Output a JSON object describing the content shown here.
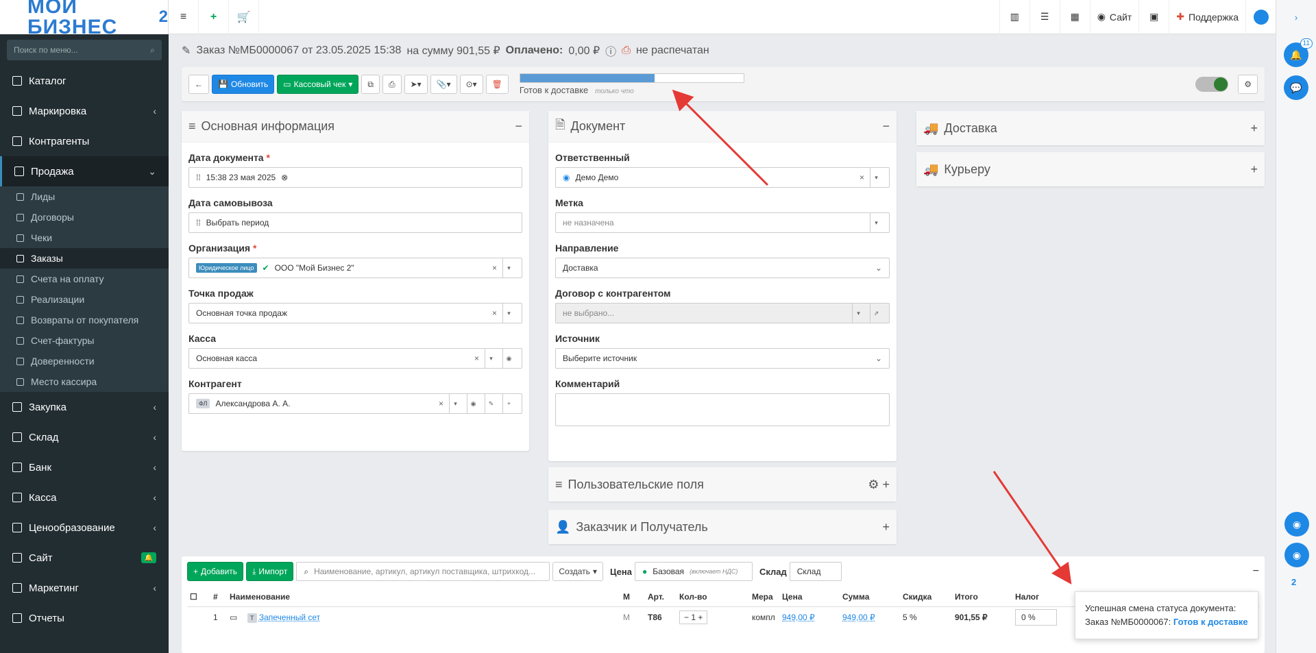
{
  "logo": {
    "text": "МОЙ БИЗНЕС",
    "suffix": "2"
  },
  "sidebar": {
    "search_placeholder": "Поиск по меню...",
    "items": [
      {
        "label": "Каталог",
        "chev": ""
      },
      {
        "label": "Маркировка",
        "chev": "‹"
      },
      {
        "label": "Контрагенты",
        "chev": ""
      },
      {
        "label": "Продажа",
        "chev": "⌄"
      }
    ],
    "sub": [
      {
        "label": "Лиды"
      },
      {
        "label": "Договоры"
      },
      {
        "label": "Чеки"
      },
      {
        "label": "Заказы"
      },
      {
        "label": "Счета на оплату"
      },
      {
        "label": "Реализации"
      },
      {
        "label": "Возвраты от покупателя"
      },
      {
        "label": "Счет-фактуры"
      },
      {
        "label": "Доверенности"
      },
      {
        "label": "Место кассира"
      }
    ],
    "items2": [
      {
        "label": "Закупка",
        "chev": "‹"
      },
      {
        "label": "Склад",
        "chev": "‹"
      },
      {
        "label": "Банк",
        "chev": "‹"
      },
      {
        "label": "Касса",
        "chev": "‹"
      },
      {
        "label": "Ценообразование",
        "chev": "‹"
      },
      {
        "label": "Сайт",
        "chev": ""
      },
      {
        "label": "Маркетинг",
        "chev": "‹"
      },
      {
        "label": "Отчеты",
        "chev": ""
      }
    ]
  },
  "topbar": {
    "site": "Сайт",
    "support": "Поддержка"
  },
  "title": {
    "order": "Заказ №МБ0000067 от 23.05.2025 15:38",
    "sum": "на сумму 901,55 ₽",
    "paid_label": "Оплачено:",
    "paid": "0,00 ₽",
    "printed": "не распечатан"
  },
  "toolbar": {
    "refresh": "Обновить",
    "cashcheck": "Кассовый чек"
  },
  "progress": {
    "fraction": 0.6,
    "label": "Готов к доставке",
    "hint": "только что"
  },
  "main": {
    "title": "Основная информация",
    "date_label": "Дата документа",
    "date_value": "15:38 23 мая 2025",
    "pickup_label": "Дата самовывоза",
    "pickup_value": "Выбрать период",
    "org_label": "Организация",
    "org_tag": "Юридическое лицо",
    "org_value": "ООО \"Мой Бизнес 2\"",
    "pos_label": "Точка продаж",
    "pos_value": "Основная точка продаж",
    "cash_label": "Касса",
    "cash_value": "Основная касса",
    "ca_label": "Контрагент",
    "ca_tag": "ФЛ",
    "ca_value": "Александрова А. А."
  },
  "doc": {
    "title": "Документ",
    "resp_label": "Ответственный",
    "resp_value": "Демо Демо",
    "mark_label": "Метка",
    "mark_value": "не назначена",
    "dir_label": "Направление",
    "dir_value": "Доставка",
    "contract_label": "Договор с контрагентом",
    "contract_value": "не выбрано...",
    "src_label": "Источник",
    "src_value": "Выберите источник",
    "comment_label": "Комментарий"
  },
  "delivery": {
    "title": "Доставка",
    "courier": "Курьеру"
  },
  "custom": {
    "title": "Пользовательские поля"
  },
  "customer": {
    "title": "Заказчик и Получатель"
  },
  "items_bar": {
    "add": "Добавить",
    "import": "Импорт",
    "search": "Наименование, артикул, артикул поставщика, штрихкод...",
    "create": "Создать",
    "price_label": "Цена",
    "price_value": "Базовая",
    "price_note": "(включает НДС)",
    "stock_label": "Склад",
    "stock_value": "Склад"
  },
  "table": {
    "headers": [
      "#",
      "Наименование",
      "М",
      "Арт.",
      "Кол-во",
      "Мера",
      "Цена",
      "Сумма",
      "Скидка",
      "Итого",
      "Налог"
    ],
    "row": {
      "n": "1",
      "t": "Т",
      "name": "Запеченный сет",
      "m": "М",
      "art": "Т86",
      "qty": "1",
      "unit": "компл",
      "price": "949,00 ₽",
      "sum": "949,00 ₽",
      "disc": "5 %",
      "total": "901,55 ₽",
      "tax": "0 %"
    }
  },
  "toast": {
    "line1": "Успешная смена статуса документа:",
    "line2": "Заказ №МБ0000067:",
    "status": "Готов к доставке"
  },
  "rightbar": {
    "badge": "11",
    "count": "2"
  }
}
